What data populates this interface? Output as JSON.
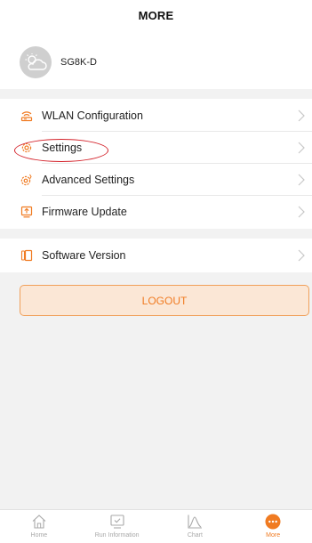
{
  "header": {
    "title": "MORE"
  },
  "profile": {
    "device_name": "SG8K-D"
  },
  "menu": {
    "items": [
      {
        "label": "WLAN Configuration",
        "icon": "wifi-router-icon"
      },
      {
        "label": "Settings",
        "icon": "gear-icon"
      },
      {
        "label": "Advanced Settings",
        "icon": "advanced-gear-icon"
      },
      {
        "label": "Firmware Update",
        "icon": "upload-icon"
      }
    ],
    "software_version_label": "Software Version"
  },
  "logout": {
    "label": "LOGOUT"
  },
  "tabbar": {
    "tabs": [
      {
        "label": "Home",
        "icon": "home-icon"
      },
      {
        "label": "Run Information",
        "icon": "monitor-icon"
      },
      {
        "label": "Chart",
        "icon": "chart-icon"
      },
      {
        "label": "More",
        "icon": "more-dots-icon",
        "active": true
      }
    ]
  },
  "colors": {
    "accent": "#f07b22",
    "highlight": "#d4232b",
    "background": "#f2f2f2"
  }
}
